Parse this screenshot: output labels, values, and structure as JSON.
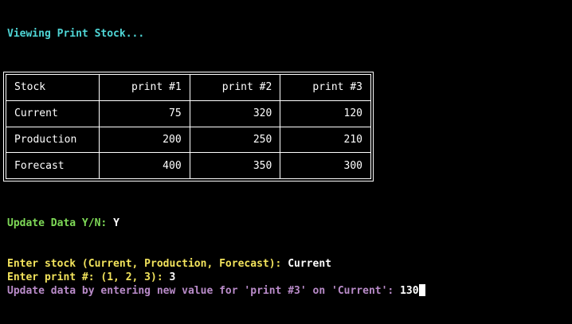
{
  "colors": {
    "background": "#000000",
    "heading": "#4fd6d6",
    "prompt_update": "#7ed957",
    "prompt_input": "#f2e35c",
    "prompt_value": "#b98bc9",
    "text": "#ffffff"
  },
  "heading": "Viewing Print Stock...",
  "table": {
    "headers": [
      "Stock",
      "print #1",
      "print #2",
      "print #3"
    ],
    "rows": [
      [
        "Current",
        "75",
        "320",
        "120"
      ],
      [
        "Production",
        "200",
        "250",
        "210"
      ],
      [
        "Forecast",
        "400",
        "350",
        "300"
      ]
    ]
  },
  "update_prompt": {
    "label": "Update Data Y/N: ",
    "answer": "Y"
  },
  "stock_prompt": {
    "label": "Enter stock (Current, Production, Forecast): ",
    "answer": "Current"
  },
  "print_prompt": {
    "label": "Enter print #: (1, 2, 3): ",
    "answer": "3"
  },
  "value_prompt": {
    "label": "Update data by entering new value for 'print #3' on 'Current': ",
    "answer": "130"
  }
}
